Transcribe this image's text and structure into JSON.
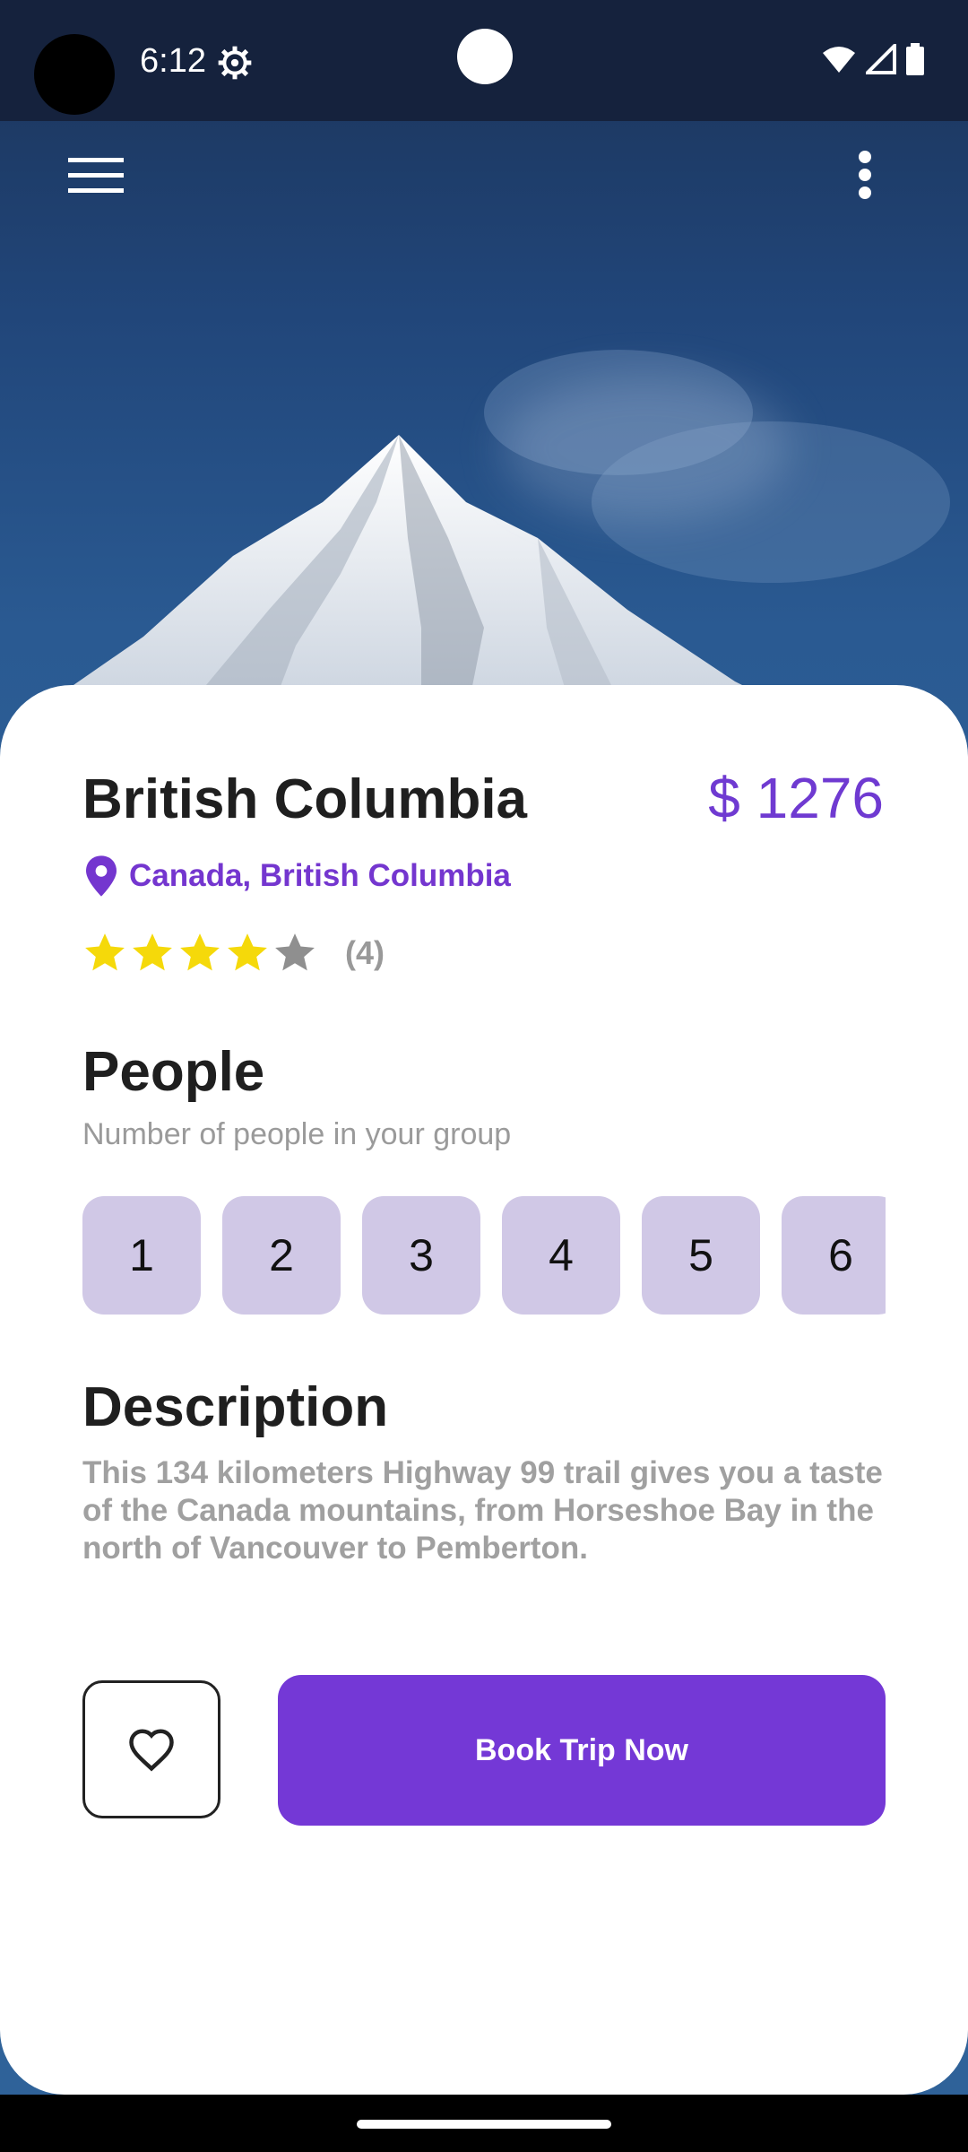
{
  "status_bar": {
    "time": "6:12"
  },
  "destination": {
    "title": "British Columbia",
    "price": "$ 1276",
    "location": "Canada, British Columbia",
    "rating_value": 4,
    "rating_max": 5,
    "rating_count": "(4)"
  },
  "people": {
    "heading": "People",
    "subtitle": "Number of people in your group",
    "options": [
      "1",
      "2",
      "3",
      "4",
      "5",
      "6"
    ]
  },
  "description": {
    "heading": "Description",
    "text": "This 134 kilometers Highway 99 trail gives you a taste of the Canada mountains, from Horseshoe Bay in the north of Vancouver to Pemberton."
  },
  "actions": {
    "book_label": "Book Trip Now"
  },
  "colors": {
    "accent": "#7438d6",
    "chip": "#d0c8e6",
    "star_on": "#f5d90a",
    "star_off": "#8f8f8f"
  },
  "icons": [
    "settings-icon",
    "wifi-icon",
    "signal-icon",
    "battery-icon",
    "menu-icon",
    "more-vert-icon",
    "location-pin-icon",
    "star-icon",
    "heart-icon"
  ]
}
